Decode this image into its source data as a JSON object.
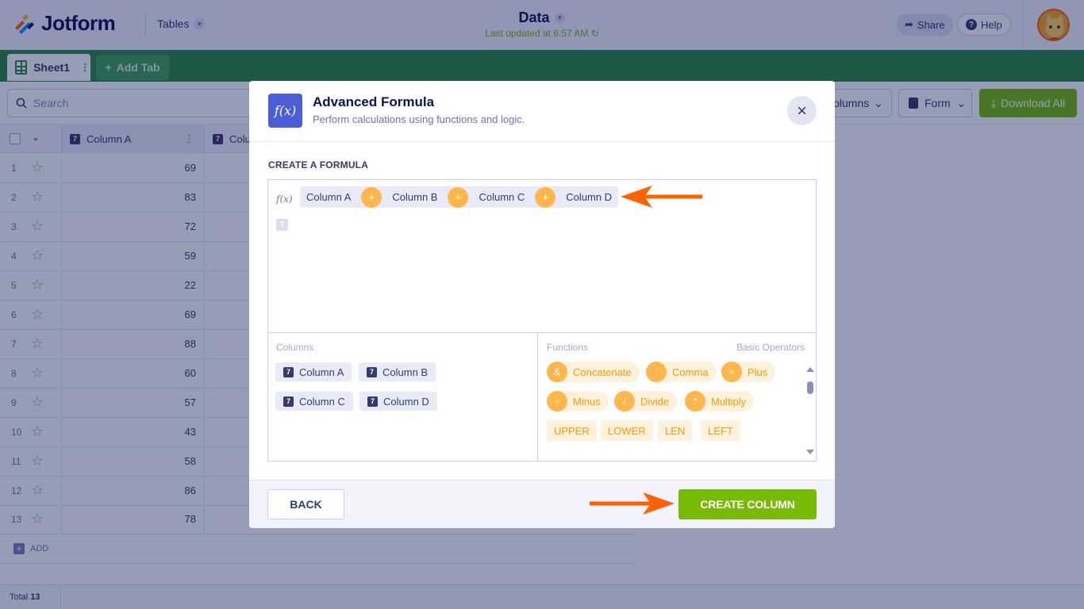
{
  "header": {
    "brand": "Jotform",
    "product_switcher": "Tables",
    "doc_title": "Data",
    "last_updated": "Last updated at 6:57 AM",
    "share_label": "Share",
    "help_label": "Help"
  },
  "tabs": {
    "sheet_label": "Sheet1",
    "add_tab_label": "Add Tab"
  },
  "toolbar": {
    "search_placeholder": "Search",
    "columns_label": "Columns",
    "form_label": "Form",
    "download_label": "Download All"
  },
  "grid": {
    "column_a_header": "Column A",
    "column_b_header": "Colu",
    "type_badge": "7",
    "rows": [
      {
        "n": "1",
        "a": "69"
      },
      {
        "n": "2",
        "a": "83"
      },
      {
        "n": "3",
        "a": "72"
      },
      {
        "n": "4",
        "a": "59"
      },
      {
        "n": "5",
        "a": "22"
      },
      {
        "n": "6",
        "a": "69"
      },
      {
        "n": "7",
        "a": "88"
      },
      {
        "n": "8",
        "a": "60"
      },
      {
        "n": "9",
        "a": "57"
      },
      {
        "n": "10",
        "a": "43"
      },
      {
        "n": "11",
        "a": "58"
      },
      {
        "n": "12",
        "a": "86"
      },
      {
        "n": "13",
        "a": "78"
      }
    ],
    "add_label": "ADD",
    "total_label": "Total",
    "total_count": "13"
  },
  "modal": {
    "icon_text": "f(x)",
    "title": "Advanced Formula",
    "subtitle": "Perform calculations using functions and logic.",
    "section_label": "CREATE A FORMULA",
    "formula_tokens": {
      "col1": "Column A",
      "op1": "+",
      "col2": "Column B",
      "op2": "+",
      "col3": "Column C",
      "op3": "+",
      "col4": "Column D"
    },
    "columns_pane_label": "Columns",
    "columns": [
      "Column A",
      "Column B",
      "Column C",
      "Column D"
    ],
    "functions_pane_label": "Functions",
    "basic_operators_label": "Basic Operators",
    "operators": [
      {
        "symbol": "&",
        "label": "Concatenate"
      },
      {
        "symbol": ",",
        "label": "Comma"
      },
      {
        "symbol": "+",
        "label": "Plus"
      },
      {
        "symbol": "-",
        "label": "Minus"
      },
      {
        "symbol": "/",
        "label": "Divide"
      },
      {
        "symbol": "*",
        "label": "Multiply"
      }
    ],
    "functions": [
      "UPPER",
      "LOWER",
      "LEN",
      "LEFT"
    ],
    "back_label": "BACK",
    "create_label": "CREATE COLUMN"
  },
  "colors": {
    "brand_green": "#2b8a3e",
    "action_green": "#78bb07",
    "accent_blue": "#4a5ed6",
    "operator_orange": "#ffb74d",
    "annotation_arrow": "#ff6100"
  },
  "icons": [
    "jotform-logo",
    "chevron-down-icon",
    "refresh-icon",
    "share-icon",
    "help-icon",
    "avatar",
    "grid-icon",
    "plus-icon",
    "search-icon",
    "form-icon",
    "download-icon",
    "star-icon",
    "close-icon",
    "function-icon",
    "text-icon",
    "arrow-annotation"
  ]
}
